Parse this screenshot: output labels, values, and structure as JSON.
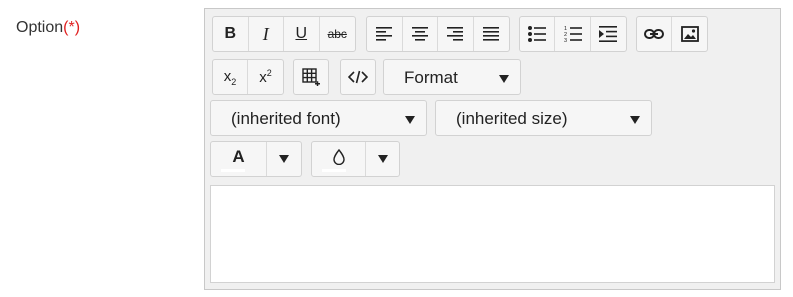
{
  "field": {
    "label": "Option",
    "required_marker": "(*)",
    "required_color": "#e02020"
  },
  "toolbar": {
    "bold_glyph": "B",
    "italic_glyph": "I",
    "underline_glyph": "U",
    "strike_glyph": "abc",
    "subscript_glyph": "x",
    "subscript_small": "2",
    "superscript_glyph": "x",
    "superscript_small": "2",
    "format_label": "Format",
    "font_label": "(inherited font)",
    "size_label": "(inherited size)",
    "text_color_glyph": "A",
    "text_color_bar": "#ffffff",
    "bg_color_bar": "#ffffff"
  },
  "icons": {
    "align_left": "align-left-icon",
    "align_center": "align-center-icon",
    "align_right": "align-right-icon",
    "justify": "justify-icon",
    "bullet_list": "bullet-list-icon",
    "numbered_list": "numbered-list-icon",
    "indent": "indent-icon",
    "link": "link-icon",
    "image": "image-icon",
    "table": "table-icon",
    "source": "code-icon",
    "background_color": "drop-icon"
  },
  "editor": {
    "content": ""
  }
}
